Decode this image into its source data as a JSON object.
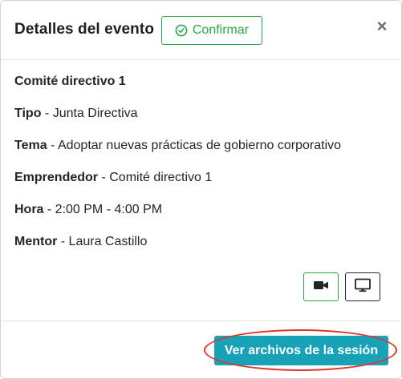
{
  "modal": {
    "title": "Detalles del evento",
    "confirm_label": "Confirmar",
    "close_symbol": "×"
  },
  "event": {
    "name": "Comité directivo 1",
    "details": [
      {
        "label": "Tipo",
        "value": " - Junta Directiva"
      },
      {
        "label": "Tema",
        "value": " - Adoptar nuevas prácticas de gobierno corporativo"
      },
      {
        "label": "Emprendedor",
        "value": " - Comité directivo 1"
      },
      {
        "label": "Hora",
        "value": " - 2:00 PM - 4:00 PM"
      },
      {
        "label": "Mentor",
        "value": " - Laura Castillo"
      }
    ]
  },
  "actions": {
    "video_icon": "video-camera-icon",
    "screen_icon": "monitor-icon"
  },
  "footer": {
    "files_label": "Ver archivos de la sesión"
  },
  "colors": {
    "success": "#28a745",
    "info": "#17a2b8",
    "annotation": "#e0352b"
  }
}
